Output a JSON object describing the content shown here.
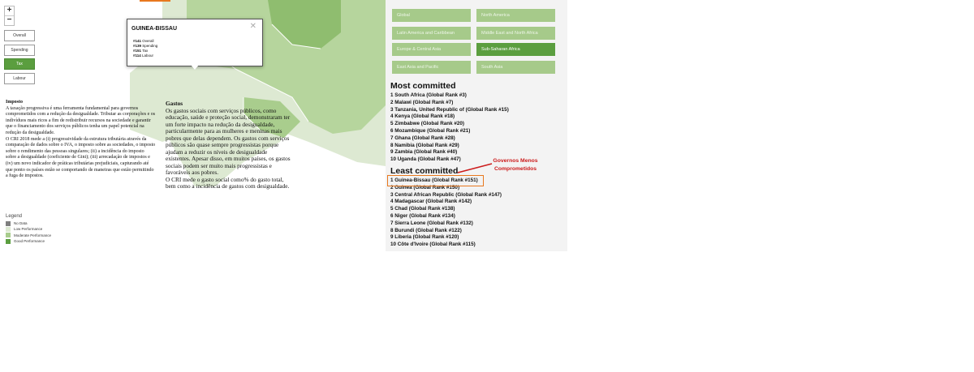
{
  "map": {
    "zoom_in": "+",
    "zoom_out": "−",
    "layers": [
      "Overall",
      "Spending",
      "Tax",
      "Labour"
    ],
    "active_layer": "Tax",
    "popup": {
      "country": "GUINEA-BISSAU",
      "close": "✕",
      "rows": [
        {
          "rank": "#141",
          "label": "Overall"
        },
        {
          "rank": "#139",
          "label": "Spending"
        },
        {
          "rank": "#151",
          "label": "Tax"
        },
        {
          "rank": "#114",
          "label": "Labour"
        }
      ]
    },
    "colors": {
      "no_data": "#7f7f7f",
      "low": "#dde9d2",
      "moderate": "#a9cd8d",
      "good": "#5b9e3f",
      "accent": "#e8781e"
    }
  },
  "text": {
    "imposto_heading": "Imposto",
    "imposto_body": "A taxação progressiva é uma ferramenta fundamental para governos comprometidos com a redução da desigualdade. Tributar as corporações e os indivíduos mais ricos a fim de redistribuir recursos na sociedade e garantir que o financiamento dos serviços públicos tenha um papel potencial na redução da desigualdade.",
    "imposto_body2": "O CRI 2018 mede a (i) progressividade da estrutura tributária através da comparação de dados sobre o IVA, o imposto sobre as sociedades, o imposto sobre o rendimento das pessoas singulares; (ii) a incidência do imposto sobre a desigualdade (coeficiente de Gini); (iii) arrecadação de impostos e (iv) um novo indicador de práticas tributárias prejudiciais, capturando até que ponto os países estão se comportando de maneiras que estão permitindo a fuga de impostos.",
    "gastos_heading": "Gastos",
    "gastos_body": "Os gastos sociais com serviços públicos, como educação, saúde e proteção social, demonstraram ter um forte impacto na redução da desigualdade, particularmente para as mulheres e meninas mais pobres que delas dependem. Os gastos com serviços públicos são quase sempre progressistas porque ajudam a reduzir os níveis de desigualdade existentes. Apesar disso, em muitos países, os gastos sociais podem ser muito mais progressistas e favoráveis aos pobres.",
    "gastos_body2": "O CRI mede o gasto social como% do gasto total, bem como a incidência de gastos com desigualdade."
  },
  "legend": {
    "title": "Legend",
    "items": [
      {
        "label": "No Data",
        "color": "#7f7f7f"
      },
      {
        "label": "Low Performance",
        "color": "#dde9d2"
      },
      {
        "label": "Moderate Performance",
        "color": "#a9cd8d"
      },
      {
        "label": "Good Performance",
        "color": "#5b9e3f"
      }
    ]
  },
  "panel": {
    "regions": [
      {
        "label": "Global",
        "active": false
      },
      {
        "label": "North America",
        "active": false
      },
      {
        "label": "Latin America and Caribbean",
        "active": false
      },
      {
        "label": "Middle East and North Africa",
        "active": false
      },
      {
        "label": "Europe & Central Asia",
        "active": false
      },
      {
        "label": "Sub-Saharan Africa",
        "active": true
      },
      {
        "label": "East Asia and Pacific",
        "active": false
      },
      {
        "label": "South Asia",
        "active": false
      }
    ],
    "most_title": "Most committed",
    "most": [
      "1 South Africa (Global Rank #3)",
      "2 Malawi (Global Rank #7)",
      "3 Tanzania, United Republic of (Global Rank #15)",
      "4 Kenya (Global Rank #18)",
      "5 Zimbabwe (Global Rank #20)",
      "6 Mozambique (Global Rank #21)",
      "7 Ghana (Global Rank #28)",
      "8 Namibia (Global Rank #29)",
      "9 Zambia (Global Rank #40)",
      "10 Uganda (Global Rank #47)"
    ],
    "least_title": "Least committed",
    "least": [
      "1 Guinea-Bissau (Global Rank #151)",
      "2 Guinea (Global Rank #150)",
      "3 Central African Republic (Global Rank #147)",
      "4 Madagascar (Global Rank #142)",
      "5 Chad (Global Rank #138)",
      "6 Niger (Global Rank #134)",
      "7 Sierra Leone (Global Rank #132)",
      "8 Burundi (Global Rank #122)",
      "9 Liberia (Global Rank #120)",
      "10 Côte d'Ivoire (Global Rank #115)"
    ]
  },
  "annotation": {
    "line1": "Governos Menos",
    "line2": "Comprometidos"
  }
}
